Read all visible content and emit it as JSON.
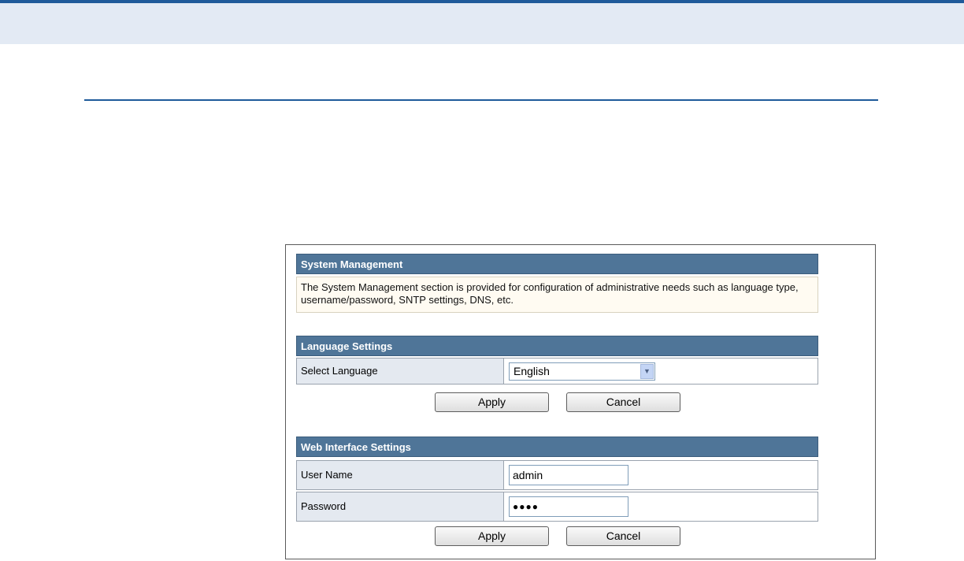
{
  "system_management": {
    "header": "System Management",
    "description": "The System Management section is provided for configuration of administrative needs such as language type, username/password, SNTP settings, DNS, etc."
  },
  "language_settings": {
    "header": "Language Settings",
    "select_label": "Select Language",
    "selected_language": "English",
    "apply_label": "Apply",
    "cancel_label": "Cancel"
  },
  "web_interface": {
    "header": "Web Interface Settings",
    "username_label": "User Name",
    "username_value": "admin",
    "password_label": "Password",
    "password_value": "●●●●",
    "apply_label": "Apply",
    "cancel_label": "Cancel"
  },
  "colors": {
    "header_bg": "#4f7598",
    "accent_line": "#1f5a9a",
    "label_bg": "#e4e9f0",
    "top_band": "#e3eaf4"
  }
}
